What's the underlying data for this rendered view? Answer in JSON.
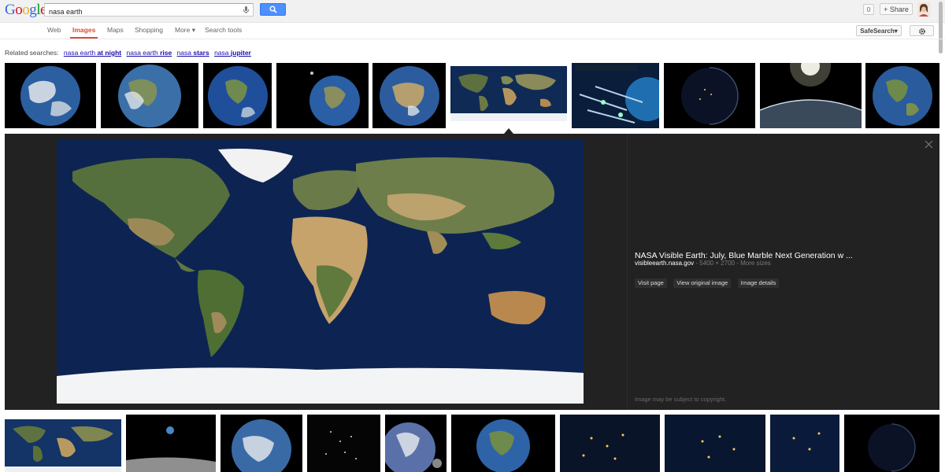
{
  "header": {
    "logo_letters": [
      {
        "char": "G",
        "color": "#3369e8"
      },
      {
        "char": "o",
        "color": "#d50f25"
      },
      {
        "char": "o",
        "color": "#eeb211"
      },
      {
        "char": "g",
        "color": "#3369e8"
      },
      {
        "char": "l",
        "color": "#009925"
      },
      {
        "char": "e",
        "color": "#d50f25"
      }
    ],
    "search_value": "nasa earth",
    "notification_count": "0",
    "share_label": "+ Share"
  },
  "nav": {
    "tabs": [
      {
        "label": "Web"
      },
      {
        "label": "Images",
        "active": true
      },
      {
        "label": "Maps"
      },
      {
        "label": "Shopping"
      },
      {
        "label": "More ▾"
      },
      {
        "label": "Search tools"
      }
    ],
    "safesearch_label": "SafeSearch▾"
  },
  "related": {
    "label": "Related searches:",
    "items": [
      {
        "base": "nasa earth",
        "bold": "at night"
      },
      {
        "base": "nasa earth",
        "bold": "rise"
      },
      {
        "base": "nasa",
        "bold": "stars"
      },
      {
        "base": "nasa",
        "bold": "jupiter"
      }
    ]
  },
  "preview": {
    "title": "NASA Visible Earth: July, Blue Marble Next Generation w ...",
    "source": "visibleearth.nasa.gov",
    "meta": " - 5400 × 2700 - More sizes",
    "buttons": [
      "Visit page",
      "View original image",
      "Image details"
    ],
    "copyright": "Image may be subject to copyright."
  },
  "colors": {
    "accent_red": "#dd4b39",
    "search_blue": "#4d90fe",
    "link_blue": "#1a0dab",
    "preview_bg": "#222222"
  }
}
